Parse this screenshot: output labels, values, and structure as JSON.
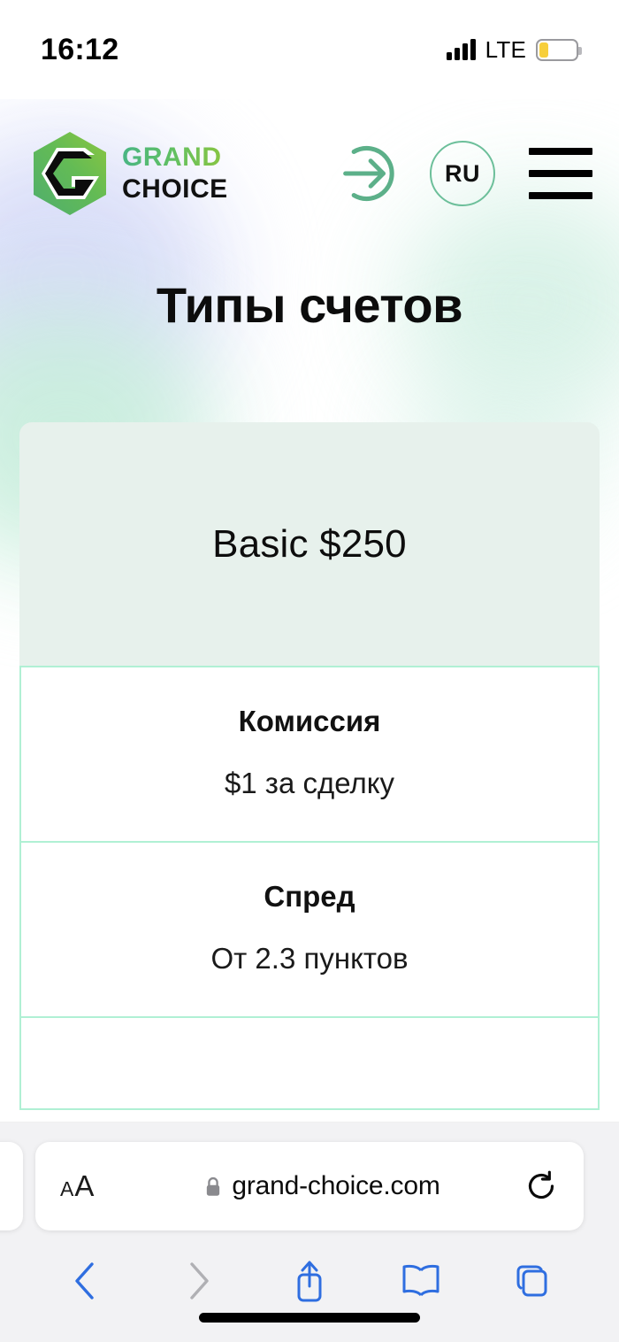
{
  "status_bar": {
    "time": "16:12",
    "network": "LTE",
    "signal_icon": "signal-bars-icon",
    "battery_icon": "battery-low-power-icon",
    "battery_level_percent": 25
  },
  "site_header": {
    "logo": {
      "mark_icon": "grand-choice-hexagon-logo-icon",
      "line1": "GRAND",
      "line2": "CHOICE",
      "green_start": "#49b584",
      "green_end": "#8cc63f"
    },
    "login_icon": "login-arrow-circle-icon",
    "language": {
      "code": "RU",
      "border_color": "#6cbf9a"
    },
    "menu_icon": "hamburger-menu-icon"
  },
  "main": {
    "page_title": "Типы счетов",
    "account_card": {
      "title": "Basic $250",
      "header_bg": "#e7f1ec",
      "border_color": "#b0f0d4",
      "rows": [
        {
          "label": "Комиссия",
          "value": "$1 за сделку"
        },
        {
          "label": "Спред",
          "value": "От 2.3 пунктов"
        },
        {
          "label": "",
          "value": ""
        }
      ]
    }
  },
  "browser": {
    "text_size_label_small": "A",
    "text_size_label_big": "A",
    "lock_icon": "lock-icon",
    "url": "grand-choice.com",
    "reload_icon": "reload-icon",
    "toolbar": {
      "back_icon": "chevron-left-icon",
      "forward_icon": "chevron-right-icon",
      "share_icon": "share-icon",
      "bookmarks_icon": "book-icon",
      "tabs_icon": "tabs-icon",
      "back_color": "#2f6ee0",
      "forward_color": "#b0b0b4",
      "accent_color": "#2f6ee0"
    },
    "home_indicator": "home-indicator"
  }
}
